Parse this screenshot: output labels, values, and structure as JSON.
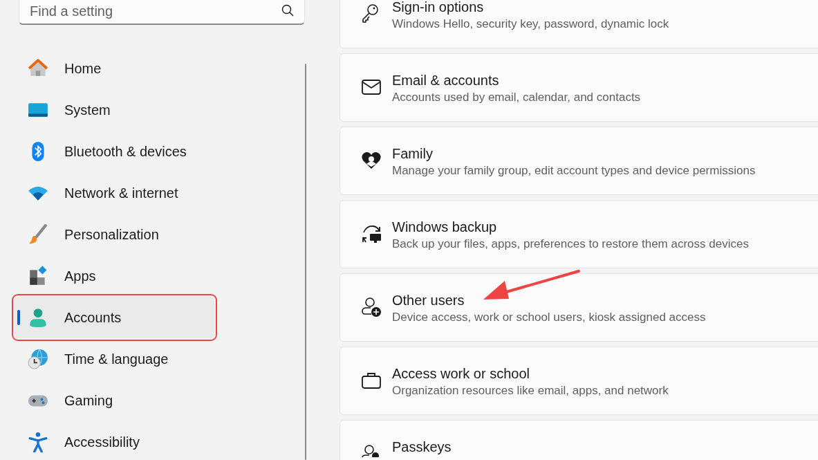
{
  "search": {
    "placeholder": "Find a setting"
  },
  "sidebar": {
    "items": [
      {
        "label": "Home",
        "selected": false,
        "highlighted": false
      },
      {
        "label": "System",
        "selected": false,
        "highlighted": false
      },
      {
        "label": "Bluetooth & devices",
        "selected": false,
        "highlighted": false
      },
      {
        "label": "Network & internet",
        "selected": false,
        "highlighted": false
      },
      {
        "label": "Personalization",
        "selected": false,
        "highlighted": false
      },
      {
        "label": "Apps",
        "selected": false,
        "highlighted": false
      },
      {
        "label": "Accounts",
        "selected": true,
        "highlighted": true
      },
      {
        "label": "Time & language",
        "selected": false,
        "highlighted": false
      },
      {
        "label": "Gaming",
        "selected": false,
        "highlighted": false
      },
      {
        "label": "Accessibility",
        "selected": false,
        "highlighted": false
      }
    ]
  },
  "settings": [
    {
      "title": "Sign-in options",
      "subtitle": "Windows Hello, security key, password, dynamic lock",
      "pointed": false
    },
    {
      "title": "Email & accounts",
      "subtitle": "Accounts used by email, calendar, and contacts",
      "pointed": false
    },
    {
      "title": "Family",
      "subtitle": "Manage your family group, edit account types and device permissions",
      "pointed": false
    },
    {
      "title": "Windows backup",
      "subtitle": "Back up your files, apps, preferences to restore them across devices",
      "pointed": false
    },
    {
      "title": "Other users",
      "subtitle": "Device access, work or school users, kiosk assigned access",
      "pointed": true
    },
    {
      "title": "Access work or school",
      "subtitle": "Organization resources like email, apps, and network",
      "pointed": false
    },
    {
      "title": "Passkeys",
      "pointed": false
    }
  ]
}
